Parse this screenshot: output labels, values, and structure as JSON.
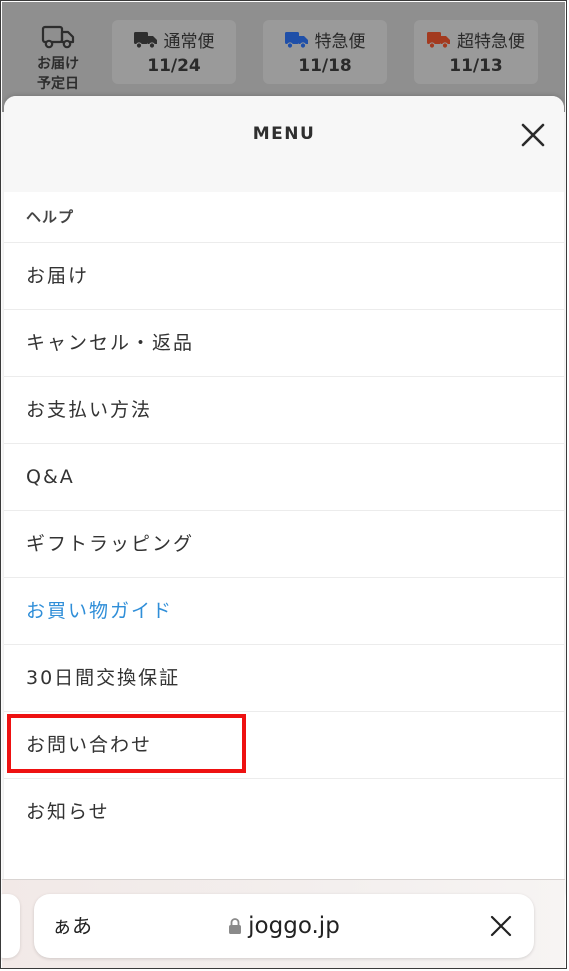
{
  "delivery": {
    "label_line1": "お届け",
    "label_line2": "予定日",
    "options": [
      {
        "name": "通常便",
        "date": "11/24",
        "color": "#2e2e2e",
        "icon": "truck-icon"
      },
      {
        "name": "特急便",
        "date": "11/18",
        "color": "#1f4fa8",
        "icon": "truck-icon"
      },
      {
        "name": "超特急便",
        "date": "11/13",
        "color": "#a33a1f",
        "icon": "truck-icon"
      }
    ]
  },
  "menu": {
    "title": "MENU",
    "close_icon": "close-icon",
    "section_label": "ヘルプ",
    "items": [
      {
        "label": "お届け"
      },
      {
        "label": "キャンセル・返品"
      },
      {
        "label": "お支払い方法"
      },
      {
        "label": "Q&A"
      },
      {
        "label": "ギフトラッピング"
      },
      {
        "label": "お買い物ガイド",
        "active": true
      },
      {
        "label": "30日間交換保証"
      },
      {
        "label": "お問い合わせ",
        "highlighted": true
      },
      {
        "label": "お知らせ"
      }
    ],
    "active_color": "#2f8ed8",
    "highlight_color": "#ee1111"
  },
  "browser": {
    "text_size_button": "ぁあ",
    "url": "joggo.jp",
    "lock_icon": "lock-icon",
    "close_icon": "close-icon"
  }
}
